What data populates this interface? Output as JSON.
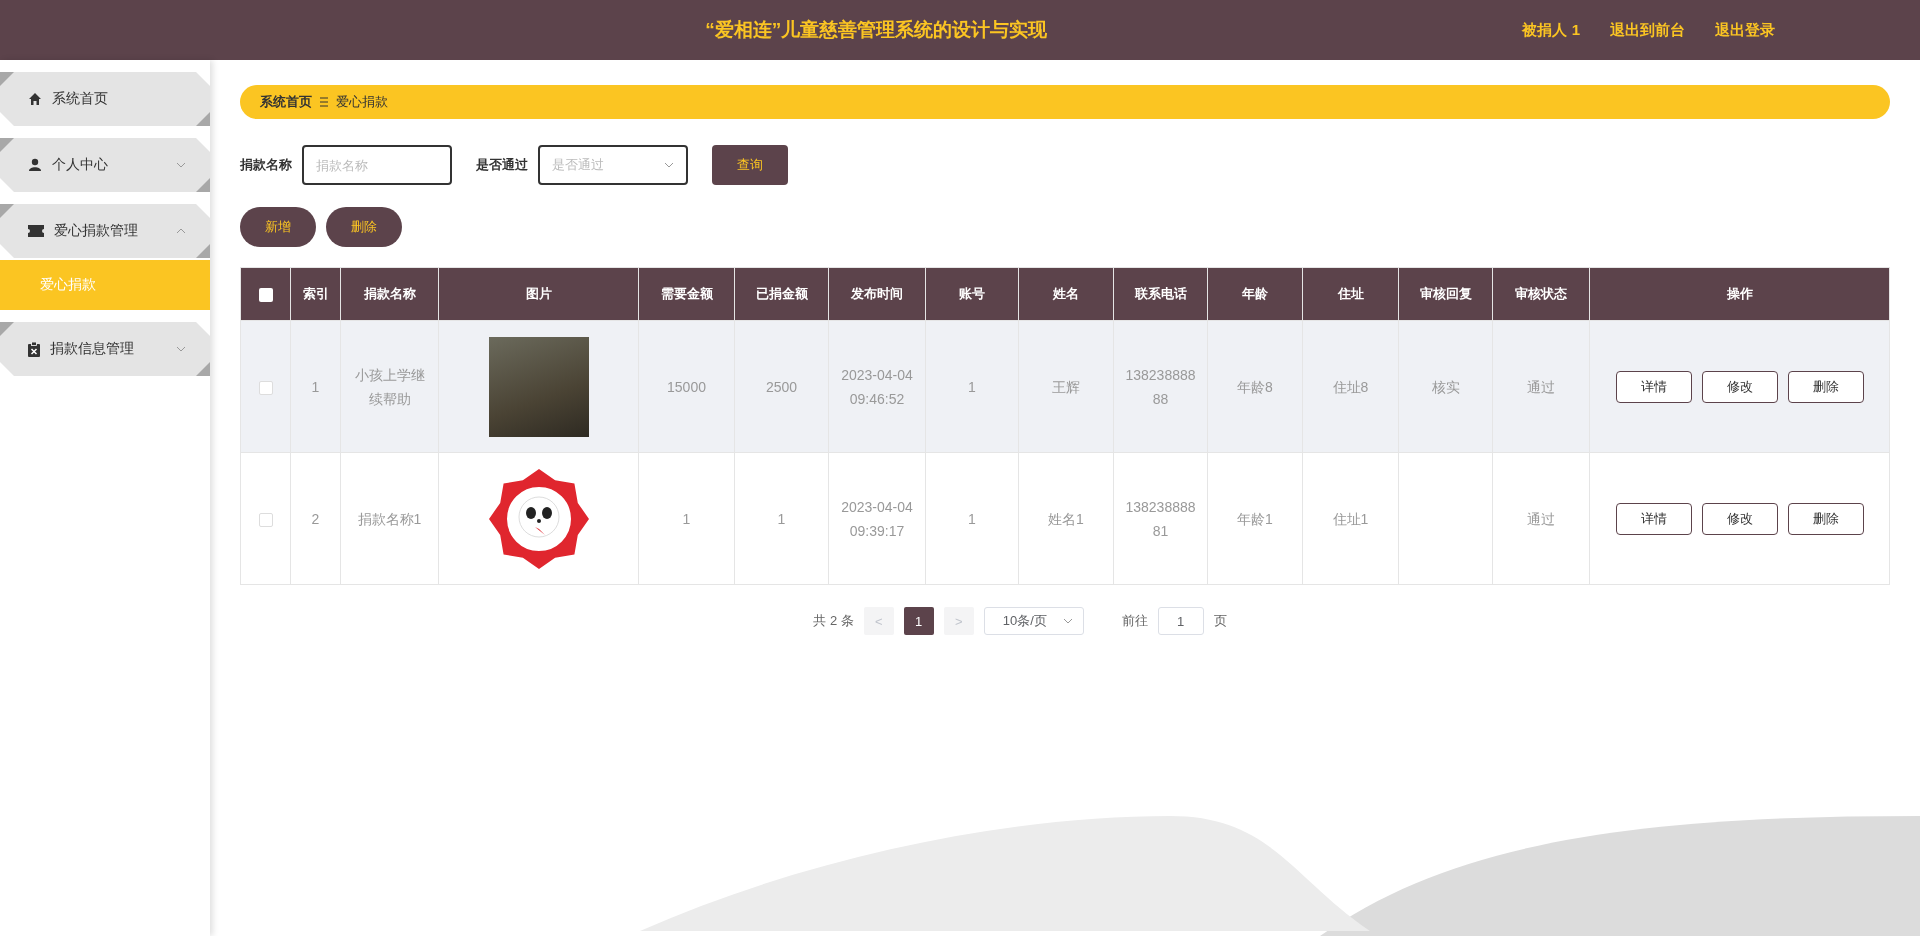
{
  "header": {
    "title": "“爱相连”儿童慈善管理系统的设计与实现",
    "links": [
      "被捐人 1",
      "退出到前台",
      "退出登录"
    ]
  },
  "sidebar": {
    "items": [
      {
        "label": "系统首页",
        "kind": "home",
        "submenu": false
      },
      {
        "label": "个人中心",
        "kind": "user",
        "submenu": true,
        "expanded": false
      },
      {
        "label": "爱心捐款管理",
        "kind": "ticket",
        "submenu": true,
        "expanded": true,
        "children": [
          {
            "label": "爱心捐款",
            "selected": true
          }
        ]
      },
      {
        "label": "捐款信息管理",
        "kind": "clipboard",
        "submenu": true,
        "expanded": false
      }
    ]
  },
  "breadcrumb": [
    "系统首页",
    "爱心捐款"
  ],
  "search": {
    "fields": [
      {
        "kind": "text",
        "label": "捐款名称",
        "placeholder": "捐款名称"
      },
      {
        "kind": "select",
        "label": "是否通过",
        "placeholder": "是否通过"
      }
    ],
    "button": "查询"
  },
  "actions": [
    "新增",
    "删除"
  ],
  "table": {
    "header_checked": false,
    "columns": [
      "索引",
      "捐款名称",
      "图片",
      "需要金额",
      "已捐金额",
      "发布时间",
      "账号",
      "姓名",
      "联系电话",
      "年龄",
      "住址",
      "审核回复",
      "审核状态",
      "操作"
    ],
    "rows": [
      {
        "checked": false,
        "hovered": true,
        "cells": [
          "1",
          "小孩上学继续帮助",
          {
            "kind": "photo"
          },
          "15000",
          "2500",
          "2023-04-04 09:46:52",
          "1",
          "王辉",
          "13823888888",
          "年龄8",
          "住址8",
          "核实",
          "通过",
          {
            "buttons": [
              "详情",
              "修改",
              "删除"
            ]
          }
        ]
      },
      {
        "checked": false,
        "hovered": false,
        "cells": [
          "2",
          "捐款名称1",
          {
            "kind": "badge"
          },
          "1",
          "1",
          "2023-04-04 09:39:17",
          "1",
          "姓名1",
          "13823888881",
          "年龄1",
          "住址1",
          "",
          "通过",
          {
            "buttons": [
              "详情",
              "修改",
              "删除"
            ]
          }
        ]
      }
    ]
  },
  "pagination": {
    "total": "共 2 条",
    "prev": "<",
    "pages": [
      {
        "label": "1",
        "selected": true
      }
    ],
    "next": ">",
    "page_size": "10条/页",
    "goto_label": "前往",
    "goto_value": "1",
    "goto_suffix": "页"
  }
}
